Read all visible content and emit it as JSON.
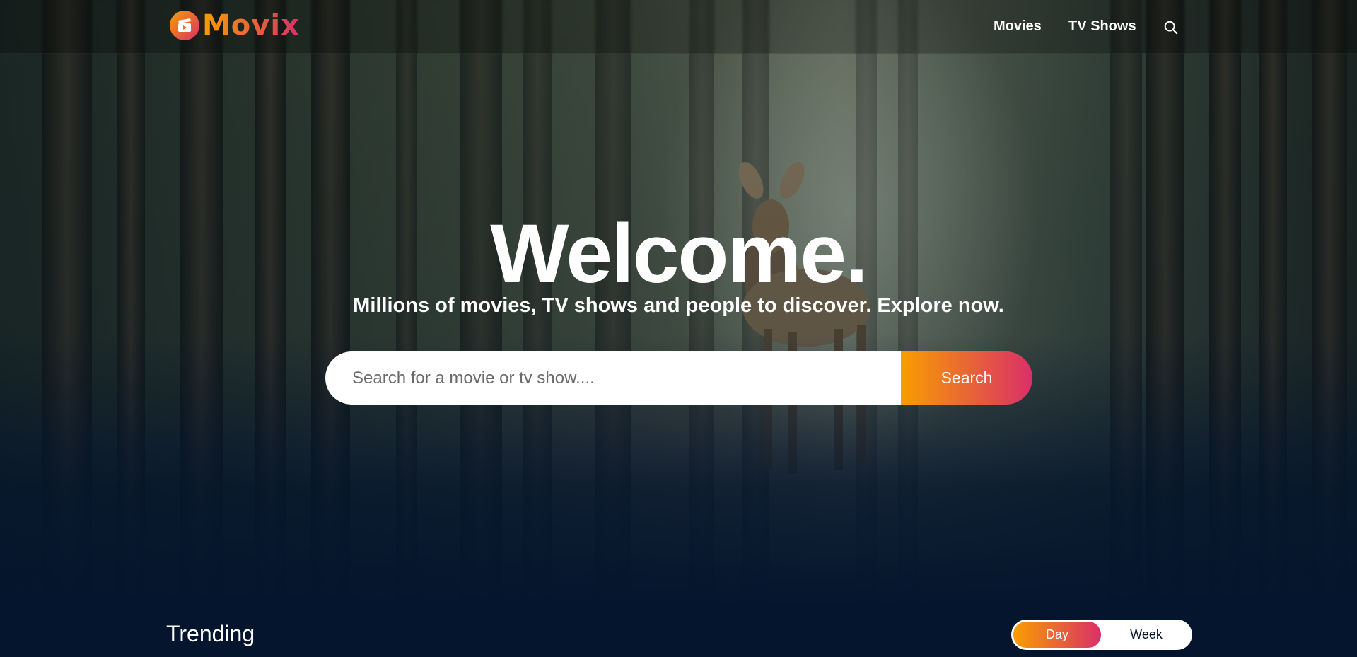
{
  "brand": {
    "name": "Movix",
    "gradient_start": "#f89e00",
    "gradient_end": "#da2f68"
  },
  "header": {
    "nav": [
      {
        "label": "Movies"
      },
      {
        "label": "TV Shows"
      }
    ],
    "search_icon": "search-icon"
  },
  "hero": {
    "title": "Welcome.",
    "subtitle": "Millions of movies, TV shows and people to discover. Explore now.",
    "search": {
      "placeholder": "Search for a movie or tv show....",
      "value": "",
      "button_label": "Search"
    }
  },
  "trending": {
    "title": "Trending",
    "tabs": [
      {
        "label": "Day",
        "active": true
      },
      {
        "label": "Week",
        "active": false
      }
    ]
  },
  "colors": {
    "page_background": "#04152d",
    "text": "#ffffff"
  }
}
